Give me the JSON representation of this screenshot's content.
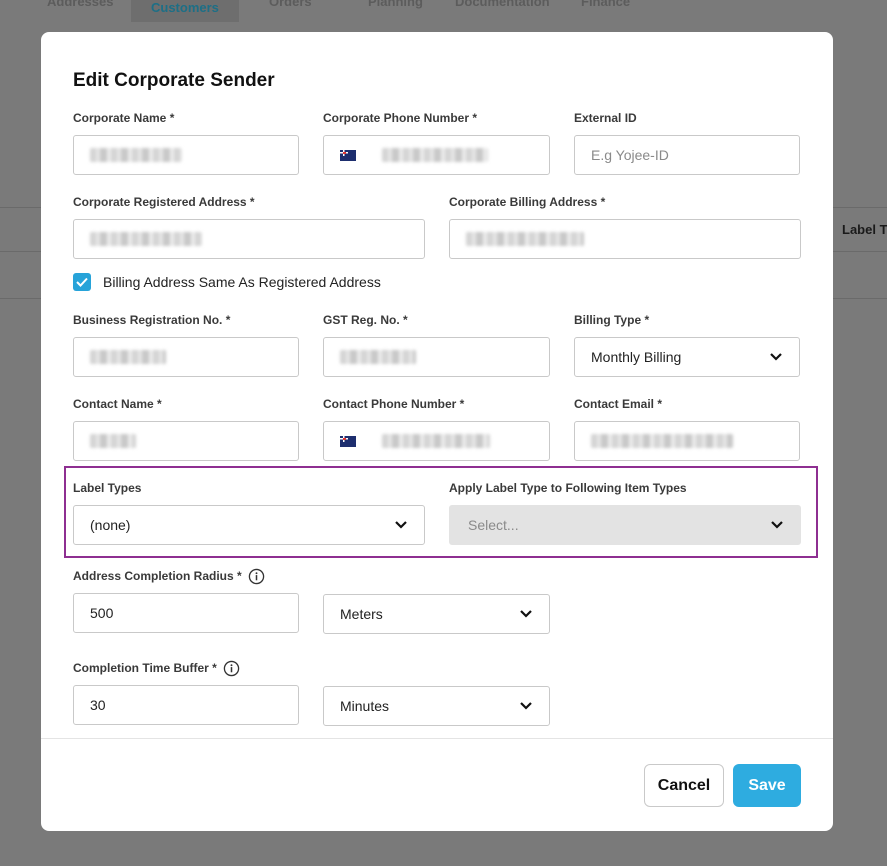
{
  "background": {
    "tabs": [
      {
        "label": "Addresses"
      },
      {
        "label": "Customers"
      },
      {
        "label": "Orders"
      },
      {
        "label": "Planning"
      },
      {
        "label": "Documentation"
      },
      {
        "label": "Finance"
      }
    ],
    "column_header": "Label T"
  },
  "modal": {
    "title": "Edit Corporate Sender",
    "corporate_name": {
      "label": "Corporate Name *"
    },
    "corporate_phone": {
      "label": "Corporate Phone Number *"
    },
    "external_id": {
      "label": "External ID",
      "placeholder": "E.g Yojee-ID"
    },
    "registered_address": {
      "label": "Corporate Registered Address *"
    },
    "billing_address": {
      "label": "Corporate Billing Address *"
    },
    "billing_same": {
      "label": "Billing Address Same As Registered Address",
      "checked": true
    },
    "business_reg": {
      "label": "Business Registration No. *"
    },
    "gst_reg": {
      "label": "GST Reg. No. *"
    },
    "billing_type": {
      "label": "Billing Type *",
      "value": "Monthly Billing"
    },
    "contact_name": {
      "label": "Contact Name *"
    },
    "contact_phone": {
      "label": "Contact Phone Number *"
    },
    "contact_email": {
      "label": "Contact Email *"
    },
    "label_types": {
      "label": "Label Types",
      "value": "(none)"
    },
    "apply_label_type": {
      "label": "Apply Label Type to Following Item Types",
      "placeholder": "Select..."
    },
    "address_radius": {
      "label": "Address Completion Radius *",
      "value": "500",
      "unit": "Meters"
    },
    "time_buffer": {
      "label": "Completion Time Buffer *",
      "value": "30",
      "unit": "Minutes"
    },
    "cancel_label": "Cancel",
    "save_label": "Save"
  },
  "colors": {
    "accent": "#2eace0",
    "highlight": "#8e2f91",
    "checkbox": "#27a3d9"
  }
}
